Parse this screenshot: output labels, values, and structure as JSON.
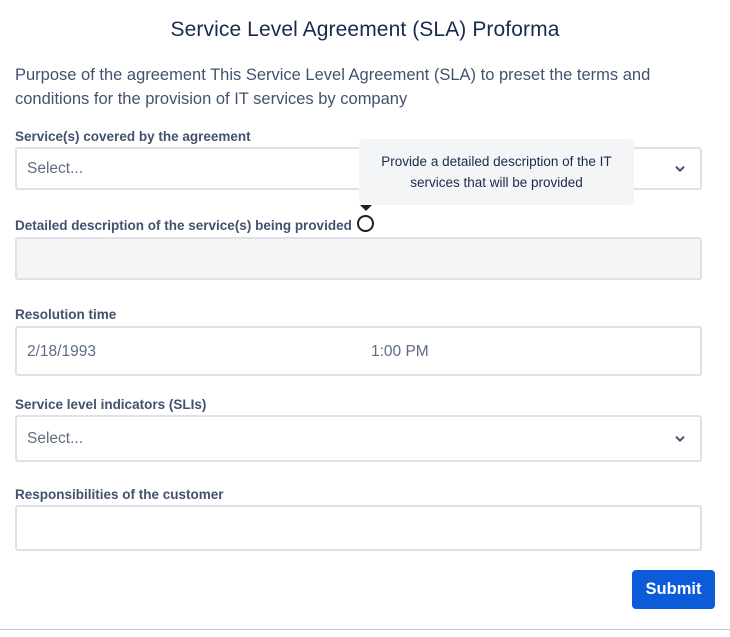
{
  "form": {
    "title": "Service Level Agreement (SLA) Proforma",
    "description": "Purpose of the agreement This Service Level Agreement (SLA) to preset the terms and conditions for the provision of IT services by company"
  },
  "fields": {
    "services_covered": {
      "label": "Service(s) covered by the agreement",
      "placeholder": "Select..."
    },
    "detailed_description": {
      "label": "Detailed description of the service(s) being provided",
      "tooltip": "Provide a detailed description of the IT services that will be provided",
      "value": ""
    },
    "resolution_time": {
      "label": "Resolution time",
      "date": "2/18/1993",
      "time": "1:00 PM"
    },
    "slis": {
      "label": "Service level indicators (SLIs)",
      "placeholder": "Select..."
    },
    "customer_responsibilities": {
      "label": "Responsibilities of the customer",
      "value": ""
    }
  },
  "actions": {
    "submit_label": "Submit"
  },
  "colors": {
    "primary_button": "#0c5cda",
    "label_text": "#42526e",
    "title_text": "#172b4d",
    "input_border": "#dfe1e6",
    "disabled_bg": "#f4f5f7"
  },
  "icons": {
    "select_chevron": "chevron-down-icon",
    "help": "info-circle-icon"
  }
}
